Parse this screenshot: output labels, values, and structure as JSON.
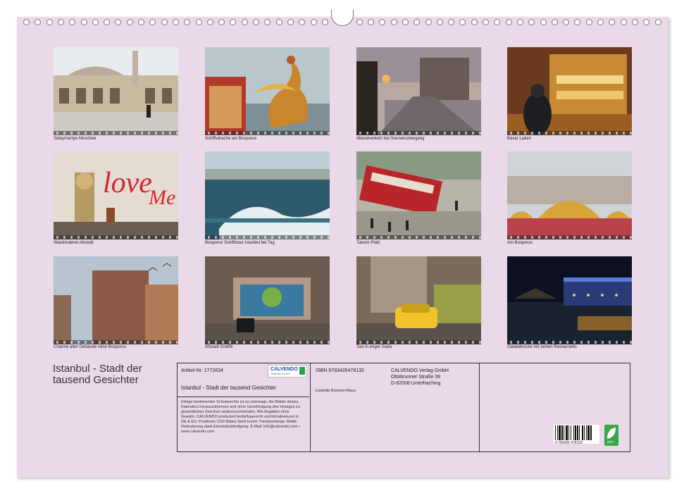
{
  "photos": [
    {
      "caption": "Süleymaniye Moschee"
    },
    {
      "caption": "Schiffsdrache am Bosporus"
    },
    {
      "caption": "Abendverkehr bei Sonnenuntergang"
    },
    {
      "caption": "Basar Laden"
    },
    {
      "caption": "Wandmalerei Altstadt"
    },
    {
      "caption": "Bosporus Schiffstour Istanbul bei Tag"
    },
    {
      "caption": "Taksim Platz"
    },
    {
      "caption": "Am Bosporus"
    },
    {
      "caption": "Charme alter Gebäude nähe Bosporus"
    },
    {
      "caption": "Altstadt Grafitti"
    },
    {
      "caption": "Taxi in enger Gaße"
    },
    {
      "caption": "Galatabrücke mit seinen Restaurants"
    }
  ],
  "title": "Istanbul - Stadt der tausend Gesichter",
  "info": {
    "article": "Artikel-Nr. 1772634",
    "product_title": "Istanbul - Stadt der tausend Gesichter",
    "legal": "Infolge bestehender Schutzrechte ist es untersagt, die Blätter dieses Kalenders herauszutrennen und ohne Genehmigung des Verlages zu gewerblichen Zwecken weiterzuverwenden. Alle Angaben ohne Gewähr. CALVENDO produziert bedarfsgerecht und klimabewusst in DE & EU. Positivere CO2-Bilanz dank kurzer Transportwege. Abfall-Reduzierung dank Einzelstückfertigung. E-Mail: info@calvendo.com • www.calvendo.com",
    "isbn": "ISBN 9783435478132",
    "author": "Liselotte Brunner-Klaus",
    "publisher_name": "CALVENDO Verlag GmbH",
    "publisher_street": "Ottobrunner Straße 39",
    "publisher_city": "D-82008 Unterhaching",
    "brand": "CALVENDO",
    "brand_tagline": "Kalender & mehr",
    "barcode_text": "9 783435 478132",
    "eco_label": "eco"
  },
  "colors": {
    "sheet": "#ead9e8",
    "border": "#333333"
  }
}
